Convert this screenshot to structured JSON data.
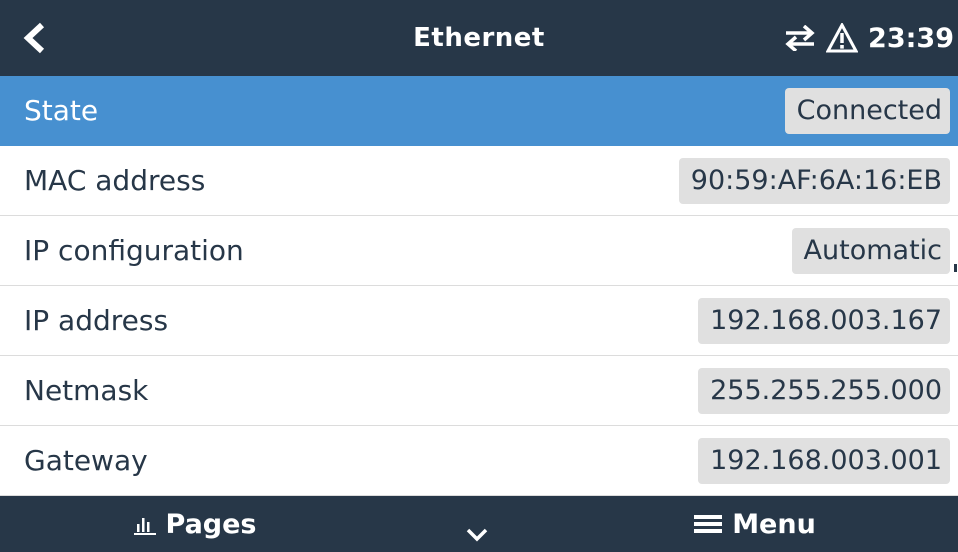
{
  "header": {
    "title": "Ethernet",
    "time": "23:39",
    "icons": {
      "back": "chevron-left-icon",
      "connection": "transfer-arrows-icon",
      "alert": "warning-icon"
    }
  },
  "rows": [
    {
      "label": "State",
      "value": "Connected",
      "selected": true
    },
    {
      "label": "MAC address",
      "value": "90:59:AF:6A:16:EB",
      "selected": false
    },
    {
      "label": "IP configuration",
      "value": "Automatic",
      "selected": false
    },
    {
      "label": "IP address",
      "value": "192.168.003.167",
      "selected": false
    },
    {
      "label": "Netmask",
      "value": "255.255.255.000",
      "selected": false
    },
    {
      "label": "Gateway",
      "value": "192.168.003.001",
      "selected": false
    }
  ],
  "footer": {
    "pages_label": "Pages",
    "menu_label": "Menu",
    "icons": {
      "pages": "bar-chart-icon",
      "scroll": "chevron-down-icon",
      "menu": "hamburger-menu-icon"
    }
  },
  "colors": {
    "bar_background": "#273748",
    "selected_row": "#4790d0",
    "value_badge": "#e0e0e0",
    "text": "#273748"
  }
}
